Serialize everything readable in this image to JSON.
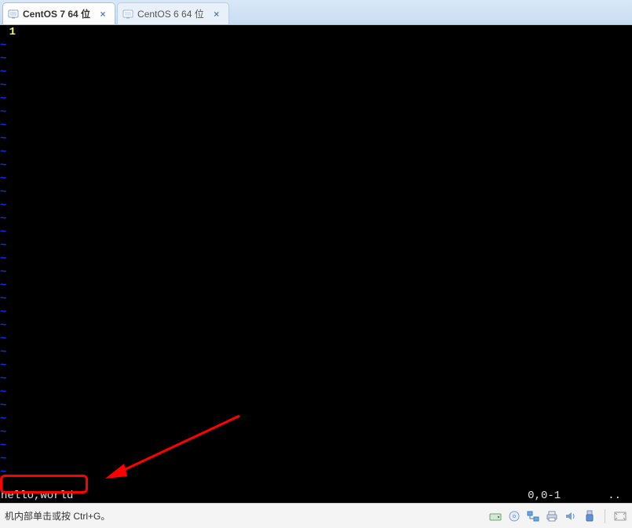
{
  "tabs": [
    {
      "label": "CentOS 7 64 位",
      "active": true
    },
    {
      "label": "CentOS 6 64 位",
      "active": false
    }
  ],
  "editor": {
    "line_number": "1",
    "tilde_count": 33,
    "status_left": "hello,world",
    "position": "0,0-1",
    "scroll_indicator": ".."
  },
  "vm_statusbar": {
    "hint": "机内部单击或按 Ctrl+G。",
    "icons": [
      "disk-icon",
      "cd-icon",
      "network-icon",
      "printer-icon",
      "sound-icon",
      "usb-icon"
    ]
  }
}
